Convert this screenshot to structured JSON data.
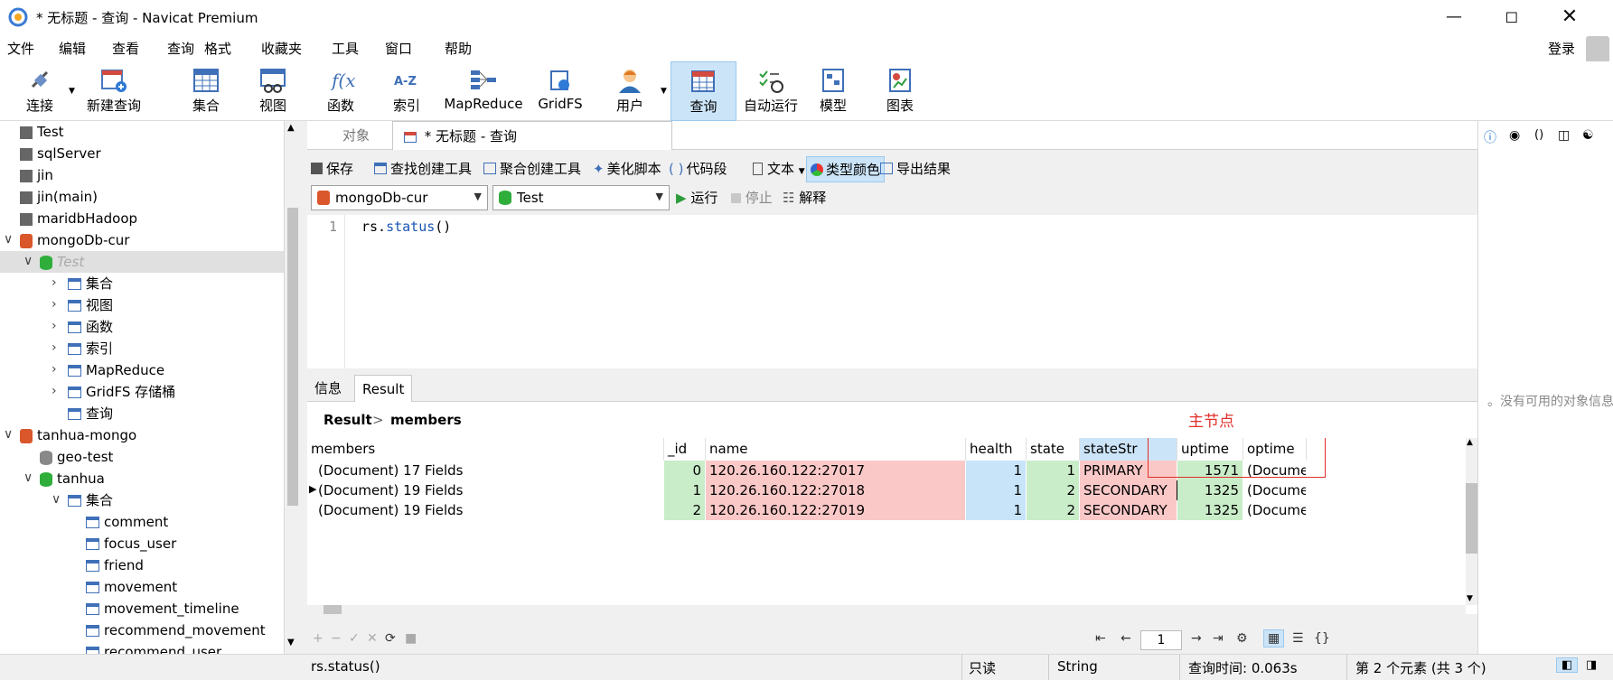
{
  "window": {
    "title": "* 无标题 - 查询 - Navicat Premium",
    "min_icon": "minimize-icon",
    "max_icon": "maximize-icon",
    "close_icon": "close-icon"
  },
  "menubar": {
    "items": [
      "文件",
      "编辑",
      "查看",
      "查询",
      "格式",
      "收藏夹",
      "工具",
      "窗口",
      "帮助"
    ],
    "login": "登录"
  },
  "toolbar": {
    "items": [
      {
        "label": "连接",
        "icon": "connect-icon"
      },
      {
        "label": "新建查询",
        "icon": "new-query-icon"
      },
      {
        "label": "集合",
        "icon": "collection-icon"
      },
      {
        "label": "视图",
        "icon": "view-icon"
      },
      {
        "label": "函数",
        "icon": "function-icon"
      },
      {
        "label": "索引",
        "icon": "index-icon"
      },
      {
        "label": "MapReduce",
        "icon": "mapreduce-icon"
      },
      {
        "label": "GridFS",
        "icon": "gridfs-icon"
      },
      {
        "label": "用户",
        "icon": "user-icon"
      },
      {
        "label": "查询",
        "icon": "query-icon"
      },
      {
        "label": "自动运行",
        "icon": "automation-icon"
      },
      {
        "label": "模型",
        "icon": "model-icon"
      },
      {
        "label": "图表",
        "icon": "chart-icon"
      }
    ]
  },
  "sidebar": {
    "items": [
      {
        "label": "Test",
        "level": 0
      },
      {
        "label": "sqlServer",
        "level": 0
      },
      {
        "label": "jin",
        "level": 0
      },
      {
        "label": "jin(main)",
        "level": 0
      },
      {
        "label": "maridbHadoop",
        "level": 0
      },
      {
        "label": "mongoDb-cur",
        "level": 0
      },
      {
        "label": "Test",
        "level": 1
      },
      {
        "label": "集合",
        "level": 2
      },
      {
        "label": "视图",
        "level": 2
      },
      {
        "label": "函数",
        "level": 2
      },
      {
        "label": "索引",
        "level": 2
      },
      {
        "label": "MapReduce",
        "level": 2
      },
      {
        "label": "GridFS 存储桶",
        "level": 2
      },
      {
        "label": "查询",
        "level": 2
      },
      {
        "label": "tanhua-mongo",
        "level": 0
      },
      {
        "label": "geo-test",
        "level": 1
      },
      {
        "label": "tanhua",
        "level": 1
      },
      {
        "label": "集合",
        "level": 2
      },
      {
        "label": "comment",
        "level": 3
      },
      {
        "label": "focus_user",
        "level": 3
      },
      {
        "label": "friend",
        "level": 3
      },
      {
        "label": "movement",
        "level": 3
      },
      {
        "label": "movement_timeline",
        "level": 3
      },
      {
        "label": "recommend_movement",
        "level": 3
      },
      {
        "label": "recommend_user",
        "level": 3
      }
    ]
  },
  "tabs": {
    "objects": "对象",
    "query": "* 无标题 - 查询"
  },
  "query_toolbar": {
    "save": "保存",
    "find_builder": "查找创建工具",
    "agg_builder": "聚合创建工具",
    "beautify": "美化脚本",
    "snippet": "代码段",
    "text": "文本",
    "type_color": "类型颜色",
    "export": "导出结果"
  },
  "selectors": {
    "connection": "mongoDb-cur",
    "database": "Test",
    "run": "运行",
    "stop": "停止",
    "explain": "解释"
  },
  "editor": {
    "line": "1",
    "code_prefix": "rs.",
    "code_func": "status",
    "code_suffix": "()"
  },
  "results": {
    "tab_info": "信息",
    "tab_result": "Result",
    "crumb_root": "Result",
    "crumb_sep": ">",
    "crumb_leaf": "members",
    "annotation": "主节点",
    "columns": [
      "members",
      "_id",
      "name",
      "health",
      "state",
      "stateStr",
      "uptime",
      "optime"
    ],
    "rows": [
      [
        "(Document) 17 Fields",
        "0",
        "120.26.160.122:27017",
        "1",
        "1",
        "PRIMARY",
        "1571",
        "(Documen"
      ],
      [
        "(Document) 19 Fields",
        "1",
        "120.26.160.122:27018",
        "1",
        "2",
        "SECONDARY",
        "1325",
        "(Documen"
      ],
      [
        "(Document) 19 Fields",
        "2",
        "120.26.160.122:27019",
        "1",
        "2",
        "SECONDARY",
        "1325",
        "(Documen"
      ]
    ]
  },
  "nav": {
    "page": "1"
  },
  "right_panel": {
    "empty_text": "没有可用的对象信息。"
  },
  "statusbar": {
    "query": "rs.status()",
    "readonly": "只读",
    "type": "String",
    "time": "查询时间: 0.063s",
    "record": "第 2 个元素 (共 3 个)"
  },
  "colors": {
    "green": "#c9ecc9",
    "red": "#fbc8c8",
    "blue": "#c8e4f8",
    "highlight": "#cce4f7",
    "annot": "#e0302a"
  }
}
